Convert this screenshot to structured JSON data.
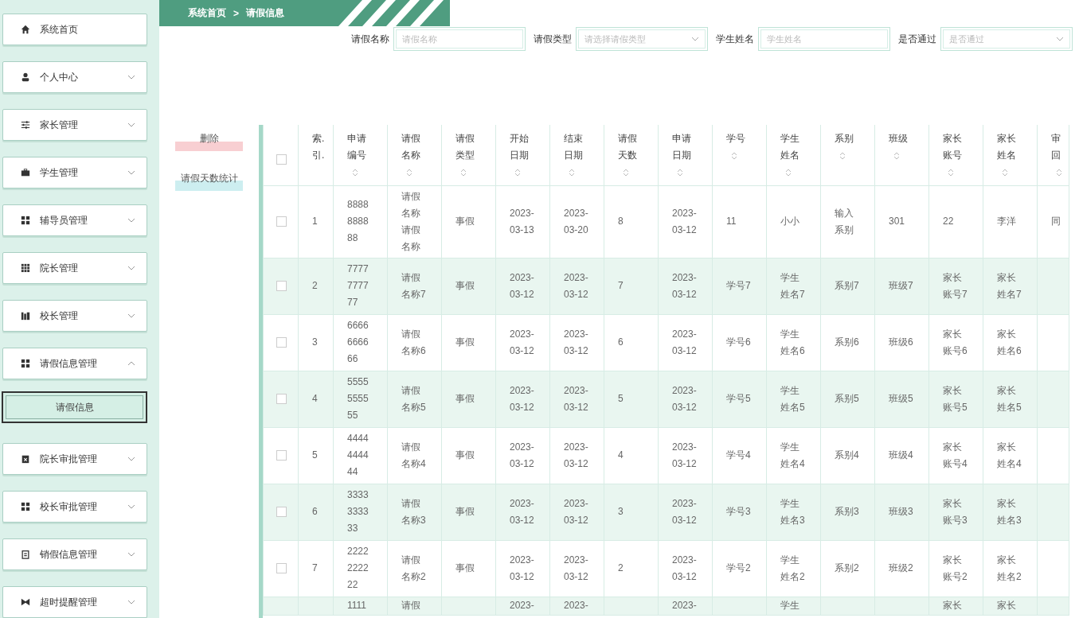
{
  "sidebar": {
    "items": [
      {
        "label": "系统首页",
        "kind": "link"
      },
      {
        "label": "个人中心",
        "kind": "menu",
        "expanded": false
      },
      {
        "label": "家长管理",
        "kind": "menu",
        "expanded": false
      },
      {
        "label": "学生管理",
        "kind": "menu",
        "expanded": false
      },
      {
        "label": "辅导员管理",
        "kind": "menu",
        "expanded": false
      },
      {
        "label": "院长管理",
        "kind": "menu",
        "expanded": false
      },
      {
        "label": "校长管理",
        "kind": "menu",
        "expanded": false
      },
      {
        "label": "请假信息管理",
        "kind": "menu",
        "expanded": true,
        "children": [
          {
            "label": "请假信息",
            "selected": true
          }
        ]
      },
      {
        "label": "院长审批管理",
        "kind": "menu",
        "expanded": false
      },
      {
        "label": "校长审批管理",
        "kind": "menu",
        "expanded": false
      },
      {
        "label": "销假信息管理",
        "kind": "menu",
        "expanded": false
      },
      {
        "label": "超时提醒管理",
        "kind": "menu",
        "expanded": false
      }
    ]
  },
  "breadcrumb": {
    "home": "系统首页",
    "separator": ">",
    "current": "请假信息"
  },
  "search": [
    {
      "label": "请假名称",
      "kind": "input",
      "placeholder": "请假名称"
    },
    {
      "label": "请假类型",
      "kind": "select",
      "placeholder": "请选择请假类型"
    },
    {
      "label": "学生姓名",
      "kind": "input",
      "placeholder": "学生姓名"
    },
    {
      "label": "是否通过",
      "kind": "select",
      "placeholder": "是否通过"
    }
  ],
  "actions": [
    {
      "label": "删除",
      "kind": "danger"
    },
    {
      "label": "请假天数统计",
      "kind": "info"
    }
  ],
  "table": {
    "select_all": {
      "checked": false
    },
    "columns": [
      {
        "label": "索.引.",
        "sortable": false
      },
      {
        "label": "申请编号",
        "sortable": true
      },
      {
        "label": "请假名称",
        "sortable": true
      },
      {
        "label": "请假类型",
        "sortable": true
      },
      {
        "label": "开始日期",
        "sortable": true
      },
      {
        "label": "结束日期",
        "sortable": true
      },
      {
        "label": "请假天数",
        "sortable": true
      },
      {
        "label": "申请日期",
        "sortable": true
      },
      {
        "label": "学号",
        "sortable": true
      },
      {
        "label": "学生姓名",
        "sortable": true
      },
      {
        "label": "系别",
        "sortable": true
      },
      {
        "label": "班级",
        "sortable": true
      },
      {
        "label": "家长账号",
        "sortable": true
      },
      {
        "label": "家长姓名",
        "sortable": true
      },
      {
        "label": "审回",
        "sortable": true
      }
    ],
    "rows": [
      {
        "selected": false,
        "cells": [
          "1",
          "8888888888",
          "请假名称请假名称",
          "事假",
          "2023-03-13",
          "2023-03-20",
          "8",
          "2023-03-12",
          "11",
          "小小",
          "输入系别",
          "301",
          "22",
          "李洋",
          "同"
        ]
      },
      {
        "selected": false,
        "cells": [
          "2",
          "7777777777",
          "请假名称7",
          "事假",
          "2023-03-12",
          "2023-03-12",
          "7",
          "2023-03-12",
          "学号7",
          "学生姓名7",
          "系别7",
          "班级7",
          "家长账号7",
          "家长姓名7"
        ]
      },
      {
        "selected": false,
        "cells": [
          "3",
          "6666666666",
          "请假名称6",
          "事假",
          "2023-03-12",
          "2023-03-12",
          "6",
          "2023-03-12",
          "学号6",
          "学生姓名6",
          "系别6",
          "班级6",
          "家长账号6",
          "家长姓名6"
        ]
      },
      {
        "selected": false,
        "cells": [
          "4",
          "5555555555",
          "请假名称5",
          "事假",
          "2023-03-12",
          "2023-03-12",
          "5",
          "2023-03-12",
          "学号5",
          "学生姓名5",
          "系别5",
          "班级5",
          "家长账号5",
          "家长姓名5"
        ]
      },
      {
        "selected": false,
        "cells": [
          "5",
          "4444444444",
          "请假名称4",
          "事假",
          "2023-03-12",
          "2023-03-12",
          "4",
          "2023-03-12",
          "学号4",
          "学生姓名4",
          "系别4",
          "班级4",
          "家长账号4",
          "家长姓名4"
        ]
      },
      {
        "selected": false,
        "cells": [
          "6",
          "3333333333",
          "请假名称3",
          "事假",
          "2023-03-12",
          "2023-03-12",
          "3",
          "2023-03-12",
          "学号3",
          "学生姓名3",
          "系别3",
          "班级3",
          "家长账号3",
          "家长姓名3"
        ]
      },
      {
        "selected": false,
        "cells": [
          "7",
          "2222222222",
          "请假名称2",
          "事假",
          "2023-03-12",
          "2023-03-12",
          "2",
          "2023-03-12",
          "学号2",
          "学生姓名2",
          "系别2",
          "班级2",
          "家长账号2",
          "家长姓名2"
        ]
      },
      {
        "cells": [
          "",
          "1111",
          "请假",
          "",
          "2023-",
          "2023-",
          "",
          "2023-",
          "",
          "学生",
          "",
          "",
          "家长",
          "家长"
        ]
      }
    ]
  }
}
